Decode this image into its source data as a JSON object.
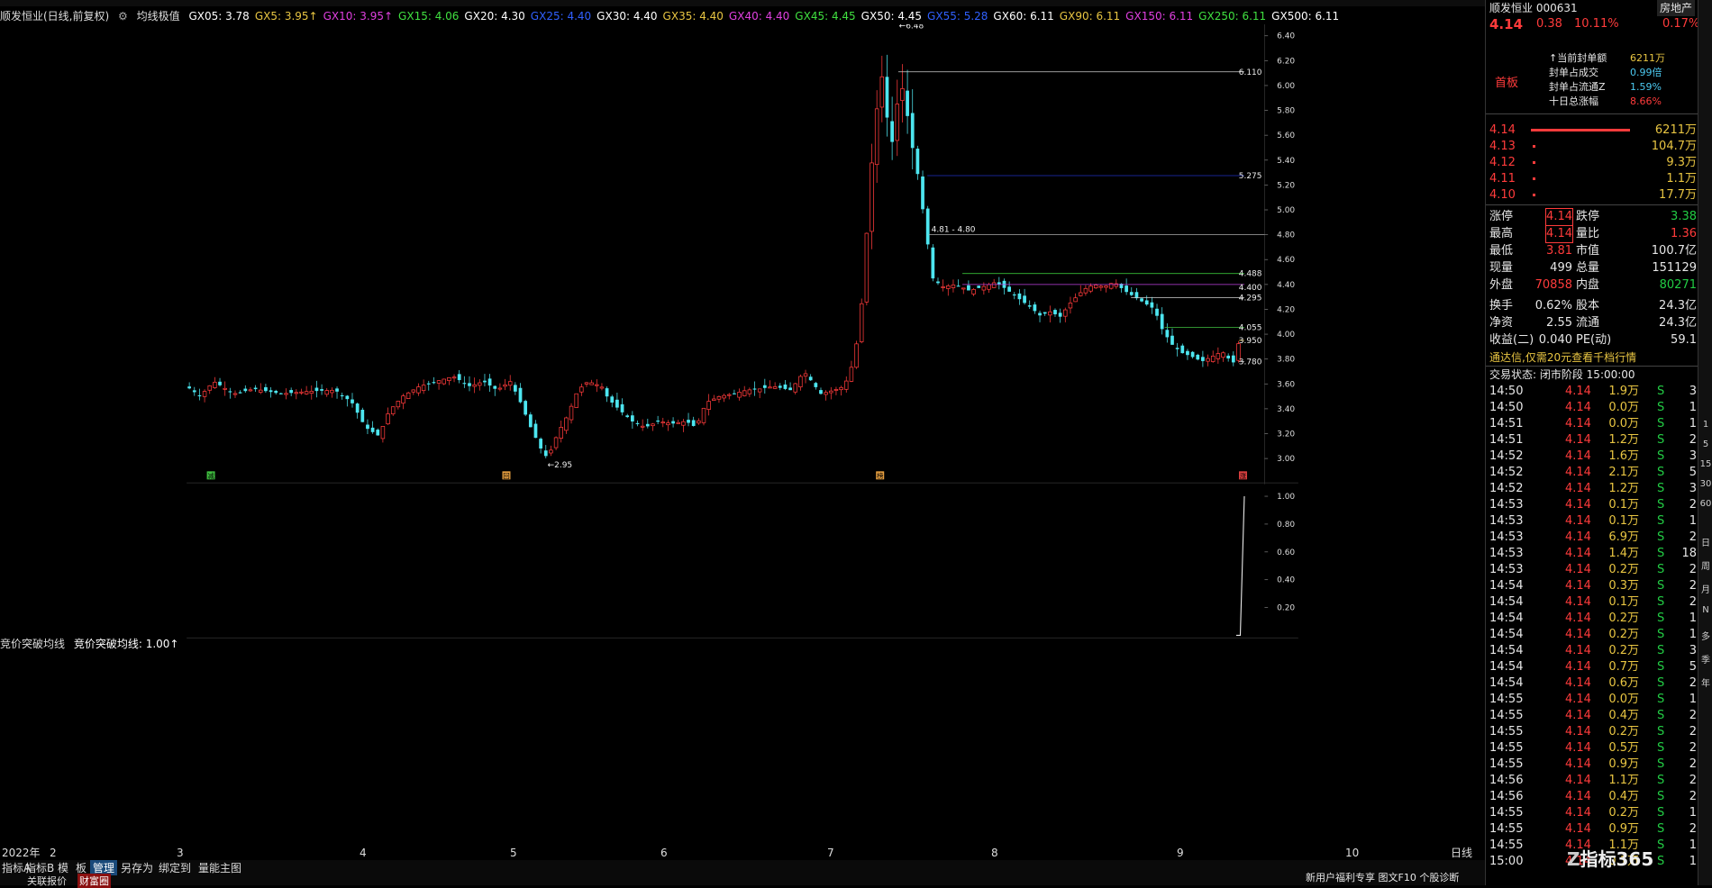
{
  "header": {
    "chart_title": "顺发恒业(日线,前复权)",
    "ma_title": "均线极值",
    "ma": [
      {
        "label": "GX05: 3.78",
        "color": "#ffffff"
      },
      {
        "label": "GX5: 3.95↑",
        "color": "#e8c542"
      },
      {
        "label": "GX10: 3.95↑",
        "color": "#e040e0"
      },
      {
        "label": "GX15: 4.06",
        "color": "#40e040"
      },
      {
        "label": "GX20: 4.30",
        "color": "#ffffff"
      },
      {
        "label": "GX25: 4.40",
        "color": "#3060ff"
      },
      {
        "label": "GX30: 4.40",
        "color": "#ffffff"
      },
      {
        "label": "GX35: 4.40",
        "color": "#e8c542"
      },
      {
        "label": "GX40: 4.40",
        "color": "#e040e0"
      },
      {
        "label": "GX45: 4.45",
        "color": "#40e040"
      },
      {
        "label": "GX50: 4.45",
        "color": "#ffffff"
      },
      {
        "label": "GX55: 5.28",
        "color": "#3060ff"
      },
      {
        "label": "GX60: 6.11",
        "color": "#ffffff"
      },
      {
        "label": "GX90: 6.11",
        "color": "#e8c542"
      },
      {
        "label": "GX150: 6.11",
        "color": "#e040e0"
      },
      {
        "label": "GX250: 6.11",
        "color": "#40e040"
      },
      {
        "label": "GX500: 6.11",
        "color": "#ffffff"
      }
    ]
  },
  "price_axis": {
    "ticks": [
      "6.40",
      "6.20",
      "6.00",
      "5.80",
      "5.60",
      "5.40",
      "5.20",
      "5.00",
      "4.80",
      "4.60",
      "4.40",
      "4.20",
      "4.00",
      "3.80",
      "3.60",
      "3.40",
      "3.20",
      "3.00"
    ]
  },
  "annotations": {
    "high": "6.48",
    "low": "2.95",
    "range": "4.81 - 4.80",
    "levels": [
      "6.110",
      "5.275",
      "4.488",
      "4.400",
      "4.295",
      "4.055",
      "3.950",
      "3.780"
    ],
    "markers": [
      "减",
      "回",
      "榜",
      "涨"
    ]
  },
  "sub_indicator": {
    "name": "竞价突破均线",
    "value_label": "竞价突破均线: 1.00↑",
    "ticks": [
      "1.00",
      "0.80",
      "0.60",
      "0.40",
      "0.20"
    ]
  },
  "date_axis": {
    "labels": [
      "2022年",
      "2",
      "3",
      "4",
      "5",
      "6",
      "7",
      "8",
      "9",
      "10"
    ],
    "period": "日线"
  },
  "bottom_tabs": [
    "指标A",
    "指标B",
    "模",
    "板",
    "管理",
    "另存为",
    "绑定到",
    "量能主图"
  ],
  "bottom_tabs2": [
    "关联报价",
    "财富圈"
  ],
  "right_panel": {
    "stock_name": "顺发恒业 000631",
    "price": "4.14",
    "change": "0.38",
    "change_pct": "10.11%",
    "side_pct": "0.17%",
    "top_btn": "房地产",
    "first_board": "首板",
    "seal": [
      {
        "k": "↑当前封单额",
        "v": "6211万"
      },
      {
        "k": "封单占成交",
        "v": "0.99倍"
      },
      {
        "k": "封单占流通Z",
        "v": "1.59%"
      },
      {
        "k": "十日总涨幅",
        "v": "8.66%"
      }
    ],
    "order_book": [
      {
        "p": "4.14",
        "v": "6211万"
      },
      {
        "p": "4.13",
        "v": "104.7万"
      },
      {
        "p": "4.12",
        "v": "9.3万"
      },
      {
        "p": "4.11",
        "v": "1.1万"
      },
      {
        "p": "4.10",
        "v": "17.7万"
      }
    ],
    "quote": [
      [
        "涨停",
        "4.14",
        "跌停",
        "3.38"
      ],
      [
        "最高",
        "4.14",
        "量比",
        "1.36"
      ],
      [
        "最低",
        "3.81",
        "市值",
        "100.7亿"
      ],
      [
        "现量",
        "499",
        "总量",
        "151129"
      ],
      [
        "外盘",
        "70858",
        "内盘",
        "80271"
      ],
      [
        "换手",
        "0.62%",
        "股本",
        "24.3亿"
      ],
      [
        "净资",
        "2.55",
        "流通",
        "24.3亿"
      ],
      [
        "收益(二)",
        "0.040",
        "PE(动)",
        "59.1"
      ]
    ],
    "notice": "通达信,仅需20元查看千档行情",
    "trade_status": "交易状态: 闭市阶段 15:00:00",
    "ticks": [
      [
        "14:50",
        "4.14",
        "1.9万",
        "S",
        "3"
      ],
      [
        "14:50",
        "4.14",
        "0.0万",
        "S",
        "1"
      ],
      [
        "14:51",
        "4.14",
        "0.0万",
        "S",
        "1"
      ],
      [
        "14:51",
        "4.14",
        "1.2万",
        "S",
        "2"
      ],
      [
        "14:52",
        "4.14",
        "1.6万",
        "S",
        "3"
      ],
      [
        "14:52",
        "4.14",
        "2.1万",
        "S",
        "5"
      ],
      [
        "14:52",
        "4.14",
        "1.2万",
        "S",
        "3"
      ],
      [
        "14:53",
        "4.14",
        "0.1万",
        "S",
        "2"
      ],
      [
        "14:53",
        "4.14",
        "0.1万",
        "S",
        "1"
      ],
      [
        "14:53",
        "4.14",
        "6.9万",
        "S",
        "2"
      ],
      [
        "14:53",
        "4.14",
        "1.4万",
        "S",
        "18"
      ],
      [
        "14:53",
        "4.14",
        "0.2万",
        "S",
        "2"
      ],
      [
        "14:54",
        "4.14",
        "0.3万",
        "S",
        "2"
      ],
      [
        "14:54",
        "4.14",
        "0.1万",
        "S",
        "2"
      ],
      [
        "14:54",
        "4.14",
        "0.2万",
        "S",
        "1"
      ],
      [
        "14:54",
        "4.14",
        "0.2万",
        "S",
        "1"
      ],
      [
        "14:54",
        "4.14",
        "0.2万",
        "S",
        "3"
      ],
      [
        "14:54",
        "4.14",
        "0.7万",
        "S",
        "5"
      ],
      [
        "14:54",
        "4.14",
        "0.6万",
        "S",
        "2"
      ],
      [
        "14:55",
        "4.14",
        "0.0万",
        "S",
        "1"
      ],
      [
        "14:55",
        "4.14",
        "0.4万",
        "S",
        "2"
      ],
      [
        "14:55",
        "4.14",
        "0.2万",
        "S",
        "2"
      ],
      [
        "14:55",
        "4.14",
        "0.5万",
        "S",
        "2"
      ],
      [
        "14:55",
        "4.14",
        "0.9万",
        "S",
        "2"
      ],
      [
        "14:56",
        "4.14",
        "1.1万",
        "S",
        "2"
      ],
      [
        "14:56",
        "4.14",
        "0.4万",
        "S",
        "2"
      ],
      [
        "14:55",
        "4.14",
        "0.2万",
        "S",
        "1"
      ],
      [
        "14:55",
        "4.14",
        "0.9万",
        "S",
        "2"
      ],
      [
        "14:55",
        "4.14",
        "1.1万",
        "S",
        "1"
      ],
      [
        "15:00",
        "4.14",
        "0.1万",
        "S",
        "1"
      ]
    ],
    "footer": "新用户福利专享 图文F10 个股诊断",
    "watermark": "指标365"
  },
  "side_strip": [
    "1",
    "5",
    "15",
    "30",
    "60",
    "日",
    "周",
    "月",
    "N",
    "多",
    "季",
    "年"
  ],
  "colors": {
    "up": "#ff3b3b",
    "down": "#4de6f0",
    "bg": "#000000"
  }
}
